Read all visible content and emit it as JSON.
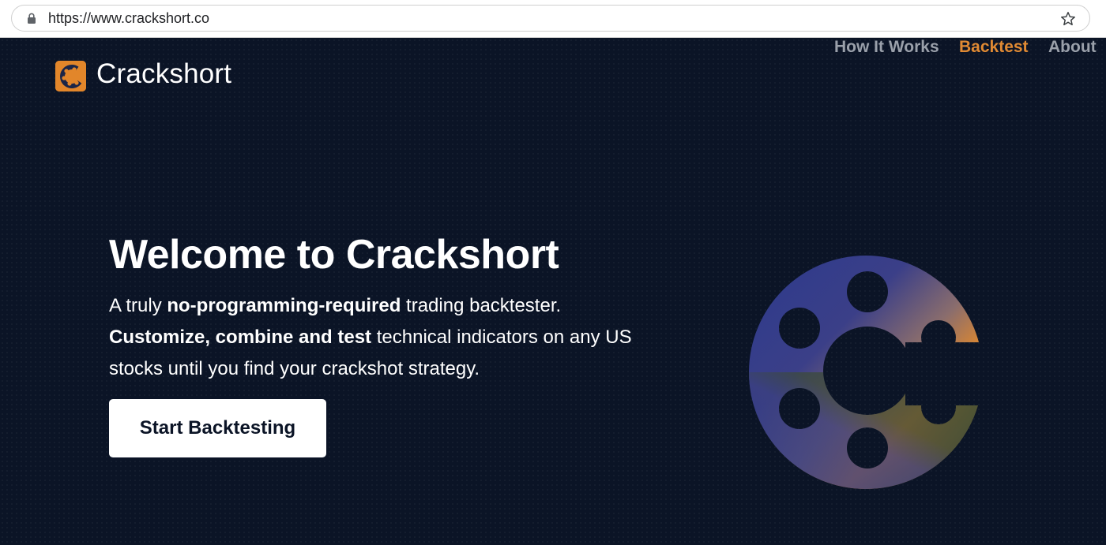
{
  "browser": {
    "url": "https://www.crackshort.co",
    "lock_icon": "lock-icon",
    "bookmark_icon": "star-icon"
  },
  "brand": {
    "name": "Crackshort",
    "logo_icon": "crackshort-logo-icon",
    "accent_color": "#e2862a"
  },
  "nav": {
    "how_it_works": "How It Works",
    "backtest": "Backtest",
    "about": "About",
    "active": "Backtest"
  },
  "hero": {
    "title": "Welcome to Crackshort",
    "line1_pre": "A truly ",
    "line1_bold": "no-programming-required",
    "line1_post": " trading backtester.",
    "line2_bold": "Customize, combine and test",
    "line2_post": " technical indicators on any US stocks until you find your crackshot strategy.",
    "cta_label": "Start Backtesting",
    "graphic_icon": "crackshort-emblem-icon"
  },
  "colors": {
    "background": "#0b1426",
    "nav_inactive": "#9aa0aa",
    "nav_active": "#e08a33",
    "emblem_blue": "#2c3a8c",
    "emblem_orange": "#e38a2b",
    "emblem_green": "#2f4a32",
    "emblem_mauve": "#8a6d6d"
  }
}
